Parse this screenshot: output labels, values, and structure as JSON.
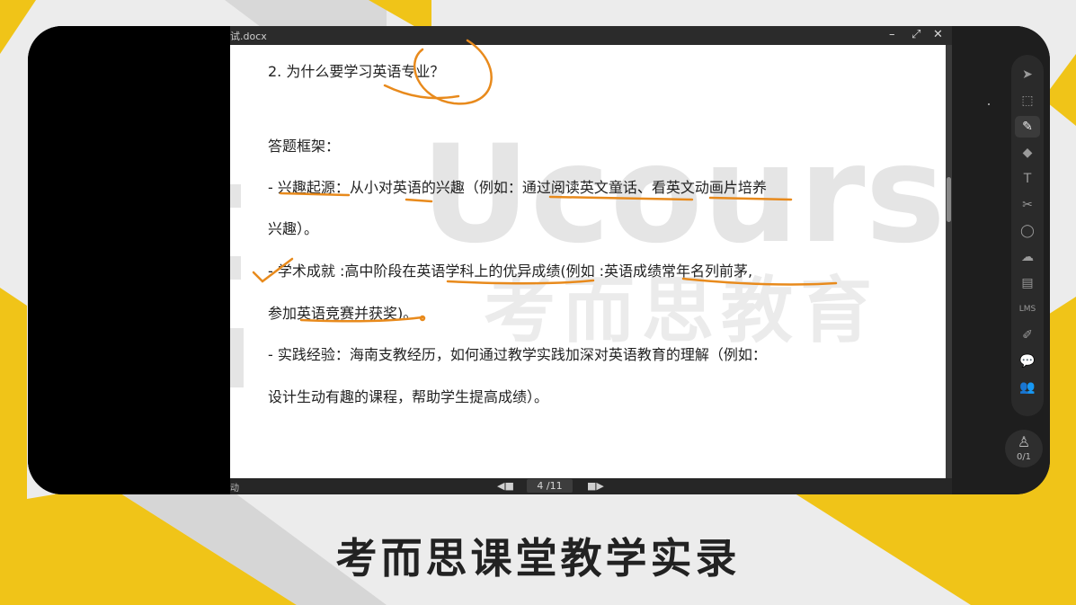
{
  "window": {
    "title": "试.docx",
    "controls": {
      "minimize": "–",
      "restore": "⤢",
      "close": "✕"
    }
  },
  "document": {
    "question": "2. 为什么要学习英语专业？",
    "framework_label": "答题框架：",
    "lines": [
      "- 兴趣起源：从小对英语的兴趣（例如：通过阅读英文童话、看英文动画片培养",
      "兴趣）。",
      "- 学术成就 :高中阶段在英语学科上的优异成绩(例如 :英语成绩常年名列前茅,",
      "参加英语竞赛并获奖)。",
      "- 实践经验：海南支教经历，如何通过教学实践加深对英语教育的理解（例如：",
      "设计生动有趣的课程，帮助学生提高成绩）。"
    ]
  },
  "bottombar": {
    "left_label": "动",
    "prev_icon": "◀■",
    "page_indicator": "4 /11",
    "next_icon": "■▶"
  },
  "toolbar": {
    "tools": [
      {
        "name": "pointer-icon",
        "glyph": "➤"
      },
      {
        "name": "select-region-icon",
        "glyph": "⬚"
      },
      {
        "name": "pen-icon",
        "glyph": "✎"
      },
      {
        "name": "eraser-icon",
        "glyph": "◆"
      },
      {
        "name": "text-icon",
        "glyph": "T"
      },
      {
        "name": "scissors-icon",
        "glyph": "✂"
      },
      {
        "name": "circle-icon",
        "glyph": "◯"
      },
      {
        "name": "cloud-icon",
        "glyph": "☁"
      },
      {
        "name": "toolbox-icon",
        "glyph": "▤"
      },
      {
        "name": "lms-icon",
        "glyph": "LMS"
      },
      {
        "name": "edit-box-icon",
        "glyph": "✐"
      },
      {
        "name": "chat-icon",
        "glyph": "💬"
      },
      {
        "name": "users-icon",
        "glyph": "👥"
      }
    ],
    "active_index": 2
  },
  "counter": {
    "icon": "seat-icon",
    "value": "0/1"
  },
  "watermark": {
    "brand": "Ucourse",
    "chinese": "考而思教育"
  },
  "caption": "考而思课堂教学实录",
  "colors": {
    "accent_yellow": "#f0c418",
    "annotation_orange": "#e88a1c"
  }
}
